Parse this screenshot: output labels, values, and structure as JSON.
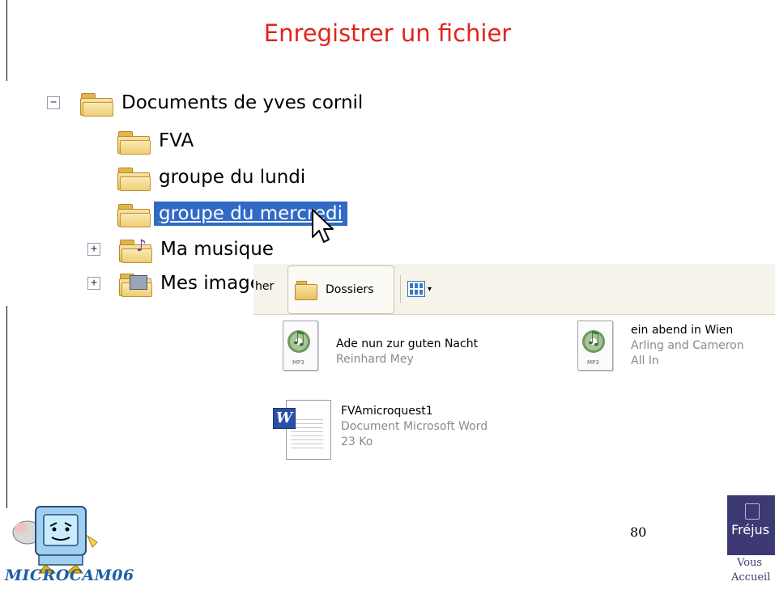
{
  "slide": {
    "title": "Enregistrer un fichier",
    "page_number": "80"
  },
  "tree": {
    "root": {
      "label": "Documents de yves cornil",
      "expander": "−",
      "expanded": true
    },
    "children": [
      {
        "label": "FVA"
      },
      {
        "label": "groupe du lundi"
      },
      {
        "label": "groupe du mercredi",
        "selected": true
      },
      {
        "label": "Ma musique",
        "expander": "+",
        "icon": "music-folder-icon"
      },
      {
        "label": "Mes images",
        "expander": "+",
        "icon": "pictures-folder-icon"
      }
    ]
  },
  "explorer": {
    "toolbar": {
      "partial_label": "her",
      "folders_button": "Dossiers",
      "views_icon": "views-icon"
    },
    "files": [
      {
        "name": "Ade nun zur guten Nacht",
        "detail1": "Reinhard Mey",
        "detail2": "",
        "type_badge": "MP3",
        "icon": "mp3-file-icon"
      },
      {
        "name": "ein abend in Wien",
        "detail1": "Arling and Cameron",
        "detail2": "All In",
        "type_badge": "MP3",
        "icon": "mp3-file-icon"
      },
      {
        "name": "FVAmicroquest1",
        "detail1": "Document Microsoft Word",
        "detail2": "23 Ko",
        "icon": "word-document-icon",
        "badge_letter": "W"
      }
    ]
  },
  "footer": {
    "left_logo_text": "MICROCAM06",
    "right_logo_name": "Fréjus",
    "right_logo_line1": "Vous",
    "right_logo_line2": "Accueil"
  },
  "colors": {
    "title": "#e1251b",
    "selection": "#316ac5",
    "logo_blue": "#1c5fa8",
    "frejus_purple": "#3d3a73"
  }
}
